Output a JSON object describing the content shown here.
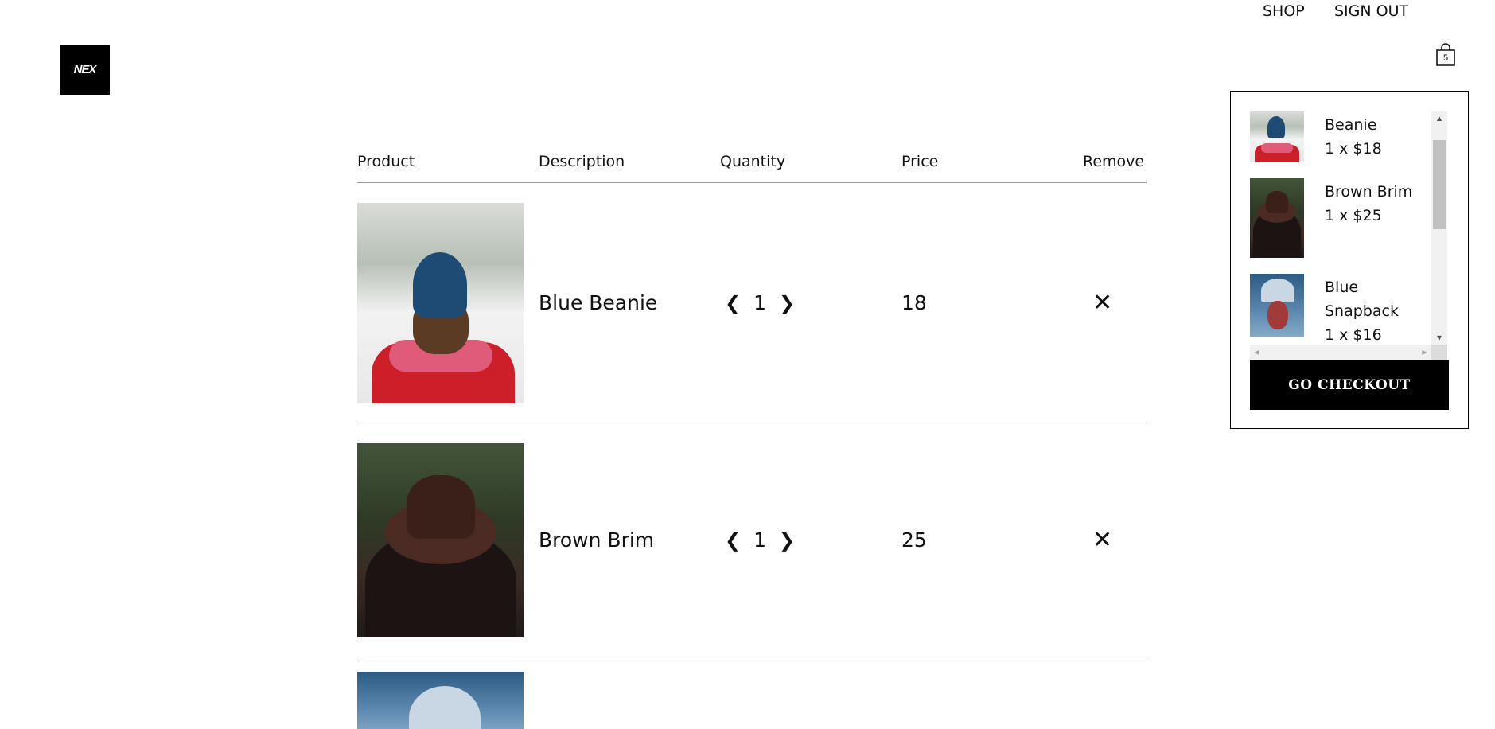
{
  "brand": {
    "logo_text": "NEX"
  },
  "nav": {
    "shop": "SHOP",
    "sign_out": "SIGN OUT",
    "cart_count": "5"
  },
  "table": {
    "headers": {
      "product": "Product",
      "description": "Description",
      "quantity": "Quantity",
      "price": "Price",
      "remove": "Remove"
    },
    "rows": [
      {
        "name": "Blue Beanie",
        "quantity": "1",
        "price": "18",
        "prev": "❮",
        "next": "❯",
        "remove": "✕"
      },
      {
        "name": "Brown Brim",
        "quantity": "1",
        "price": "25",
        "prev": "❮",
        "next": "❯",
        "remove": "✕"
      }
    ]
  },
  "cart_dropdown": {
    "items": [
      {
        "name": "Beanie",
        "line": "1 x $18"
      },
      {
        "name": "Brown Brim",
        "line": "1 x $25"
      },
      {
        "name": "Blue Snapback",
        "line": "1 x $16"
      }
    ],
    "checkout_label": "GO CHECKOUT"
  }
}
